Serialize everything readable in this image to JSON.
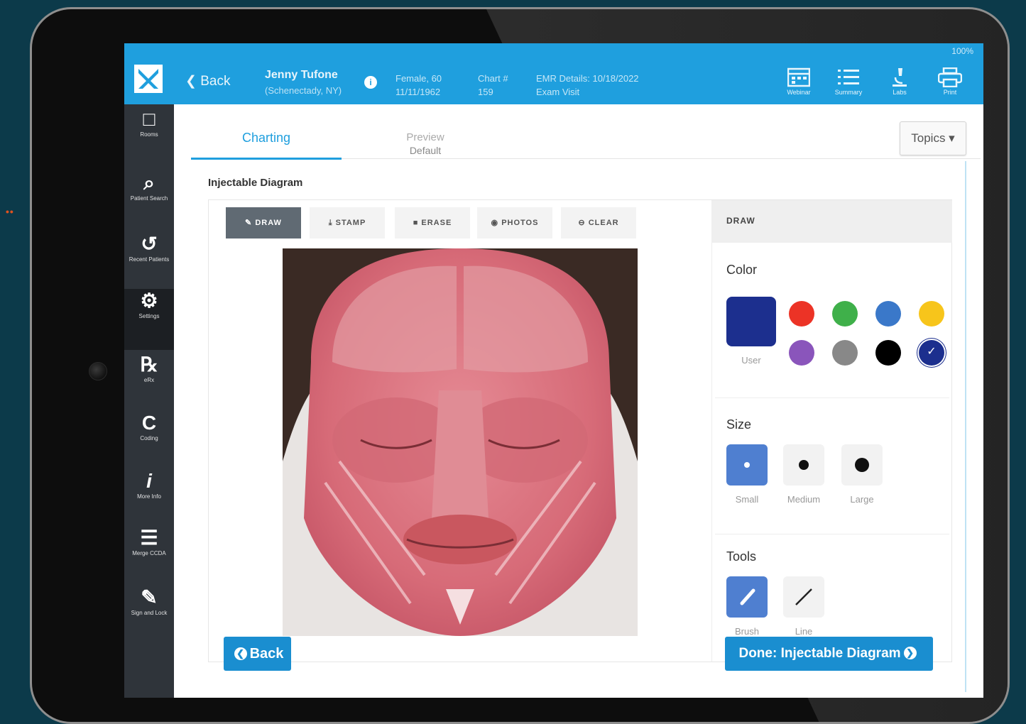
{
  "topbar": {
    "back_label": "Back",
    "patient_name": "Jenny Tufone",
    "patient_city": "(Schenectady, NY)",
    "demographics_1": "Female, 60",
    "demographics_2": "11/11/1962",
    "chart_label": "Chart #",
    "chart_number": "159",
    "emr_label": "EMR Details: 10/18/2022",
    "emr_sub": "Exam Visit",
    "status": "100%",
    "icons": [
      {
        "name": "calendar-icon",
        "label": "Webinar"
      },
      {
        "name": "list-icon",
        "label": "Summary"
      },
      {
        "name": "microscope-icon",
        "label": "Labs"
      },
      {
        "name": "printer-icon",
        "label": "Print"
      }
    ]
  },
  "sidebar": {
    "items": [
      {
        "glyph": "□",
        "label": "Rooms"
      },
      {
        "glyph": "⌕",
        "label": "Patient Search"
      },
      {
        "glyph": "↺",
        "label": "Recent Patients"
      },
      {
        "glyph": "⚙",
        "label": "Settings"
      },
      {
        "glyph": "℞",
        "label": "eRx"
      },
      {
        "glyph": "C",
        "label": "Coding"
      },
      {
        "glyph": "i",
        "label": "More Info"
      },
      {
        "glyph": "☰",
        "label": "Merge CCDA"
      },
      {
        "glyph": "✎",
        "label": "Sign and Lock"
      }
    ]
  },
  "tabs": {
    "charting": "Charting",
    "preview": "Preview",
    "preview_sub": "Default"
  },
  "topics_label": "Topics ▾",
  "section_title": "Injectable Diagram",
  "toolbar": {
    "draw": "DRAW",
    "stamp": "STAMP",
    "erase": "ERASE",
    "photos": "PHOTOS",
    "clear": "CLEAR"
  },
  "panel": {
    "header": "DRAW",
    "color_label": "Color",
    "user_label": "User",
    "user_color": "#1c2f8e",
    "colors": [
      "#ec3326",
      "#3fb04a",
      "#3a78c9",
      "#f7c51b",
      "#8a55bb",
      "#888888",
      "#000000",
      "#1c2f8e"
    ],
    "selected_color_index": 7,
    "size_label": "Size",
    "sizes": [
      "Small",
      "Medium",
      "Large"
    ],
    "selected_size": "Small",
    "tools_label": "Tools",
    "tools": [
      "Brush",
      "Line"
    ],
    "selected_tool": "Brush"
  },
  "footer": {
    "back": "Back",
    "done": "Done: Injectable Diagram"
  }
}
